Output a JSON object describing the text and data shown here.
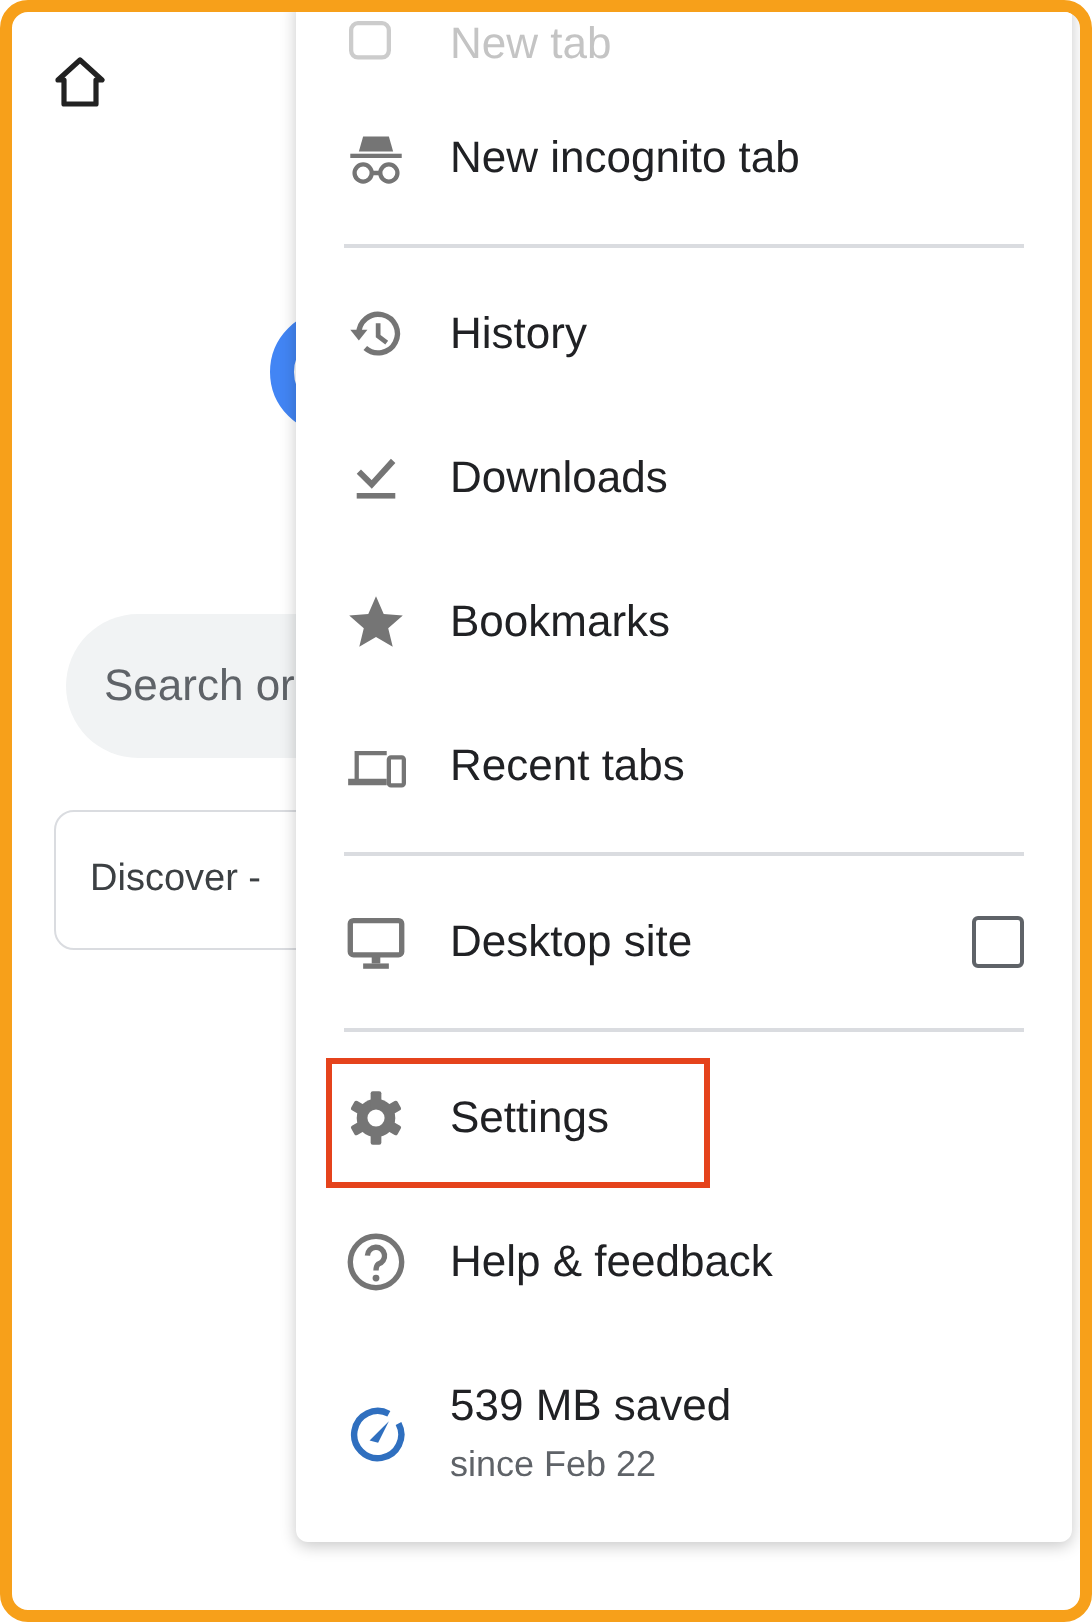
{
  "page": {
    "search": {
      "placeholder": "Search or"
    },
    "discover": {
      "label": "Discover -"
    }
  },
  "menu": {
    "items": [
      {
        "kind": "faded",
        "label": "New tab"
      },
      {
        "kind": "item",
        "label": "New incognito tab"
      },
      {
        "kind": "divider"
      },
      {
        "kind": "item",
        "label": "History"
      },
      {
        "kind": "item",
        "label": "Downloads"
      },
      {
        "kind": "item",
        "label": "Bookmarks"
      },
      {
        "kind": "item",
        "label": "Recent tabs"
      },
      {
        "kind": "divider"
      },
      {
        "kind": "checkbox",
        "label": "Desktop site",
        "checked": false
      },
      {
        "kind": "divider"
      },
      {
        "kind": "item",
        "label": "Settings",
        "highlighted": true
      },
      {
        "kind": "item",
        "label": "Help & feedback"
      },
      {
        "kind": "savings",
        "label": "539 MB saved",
        "sublabel": "since Feb 22"
      }
    ]
  }
}
